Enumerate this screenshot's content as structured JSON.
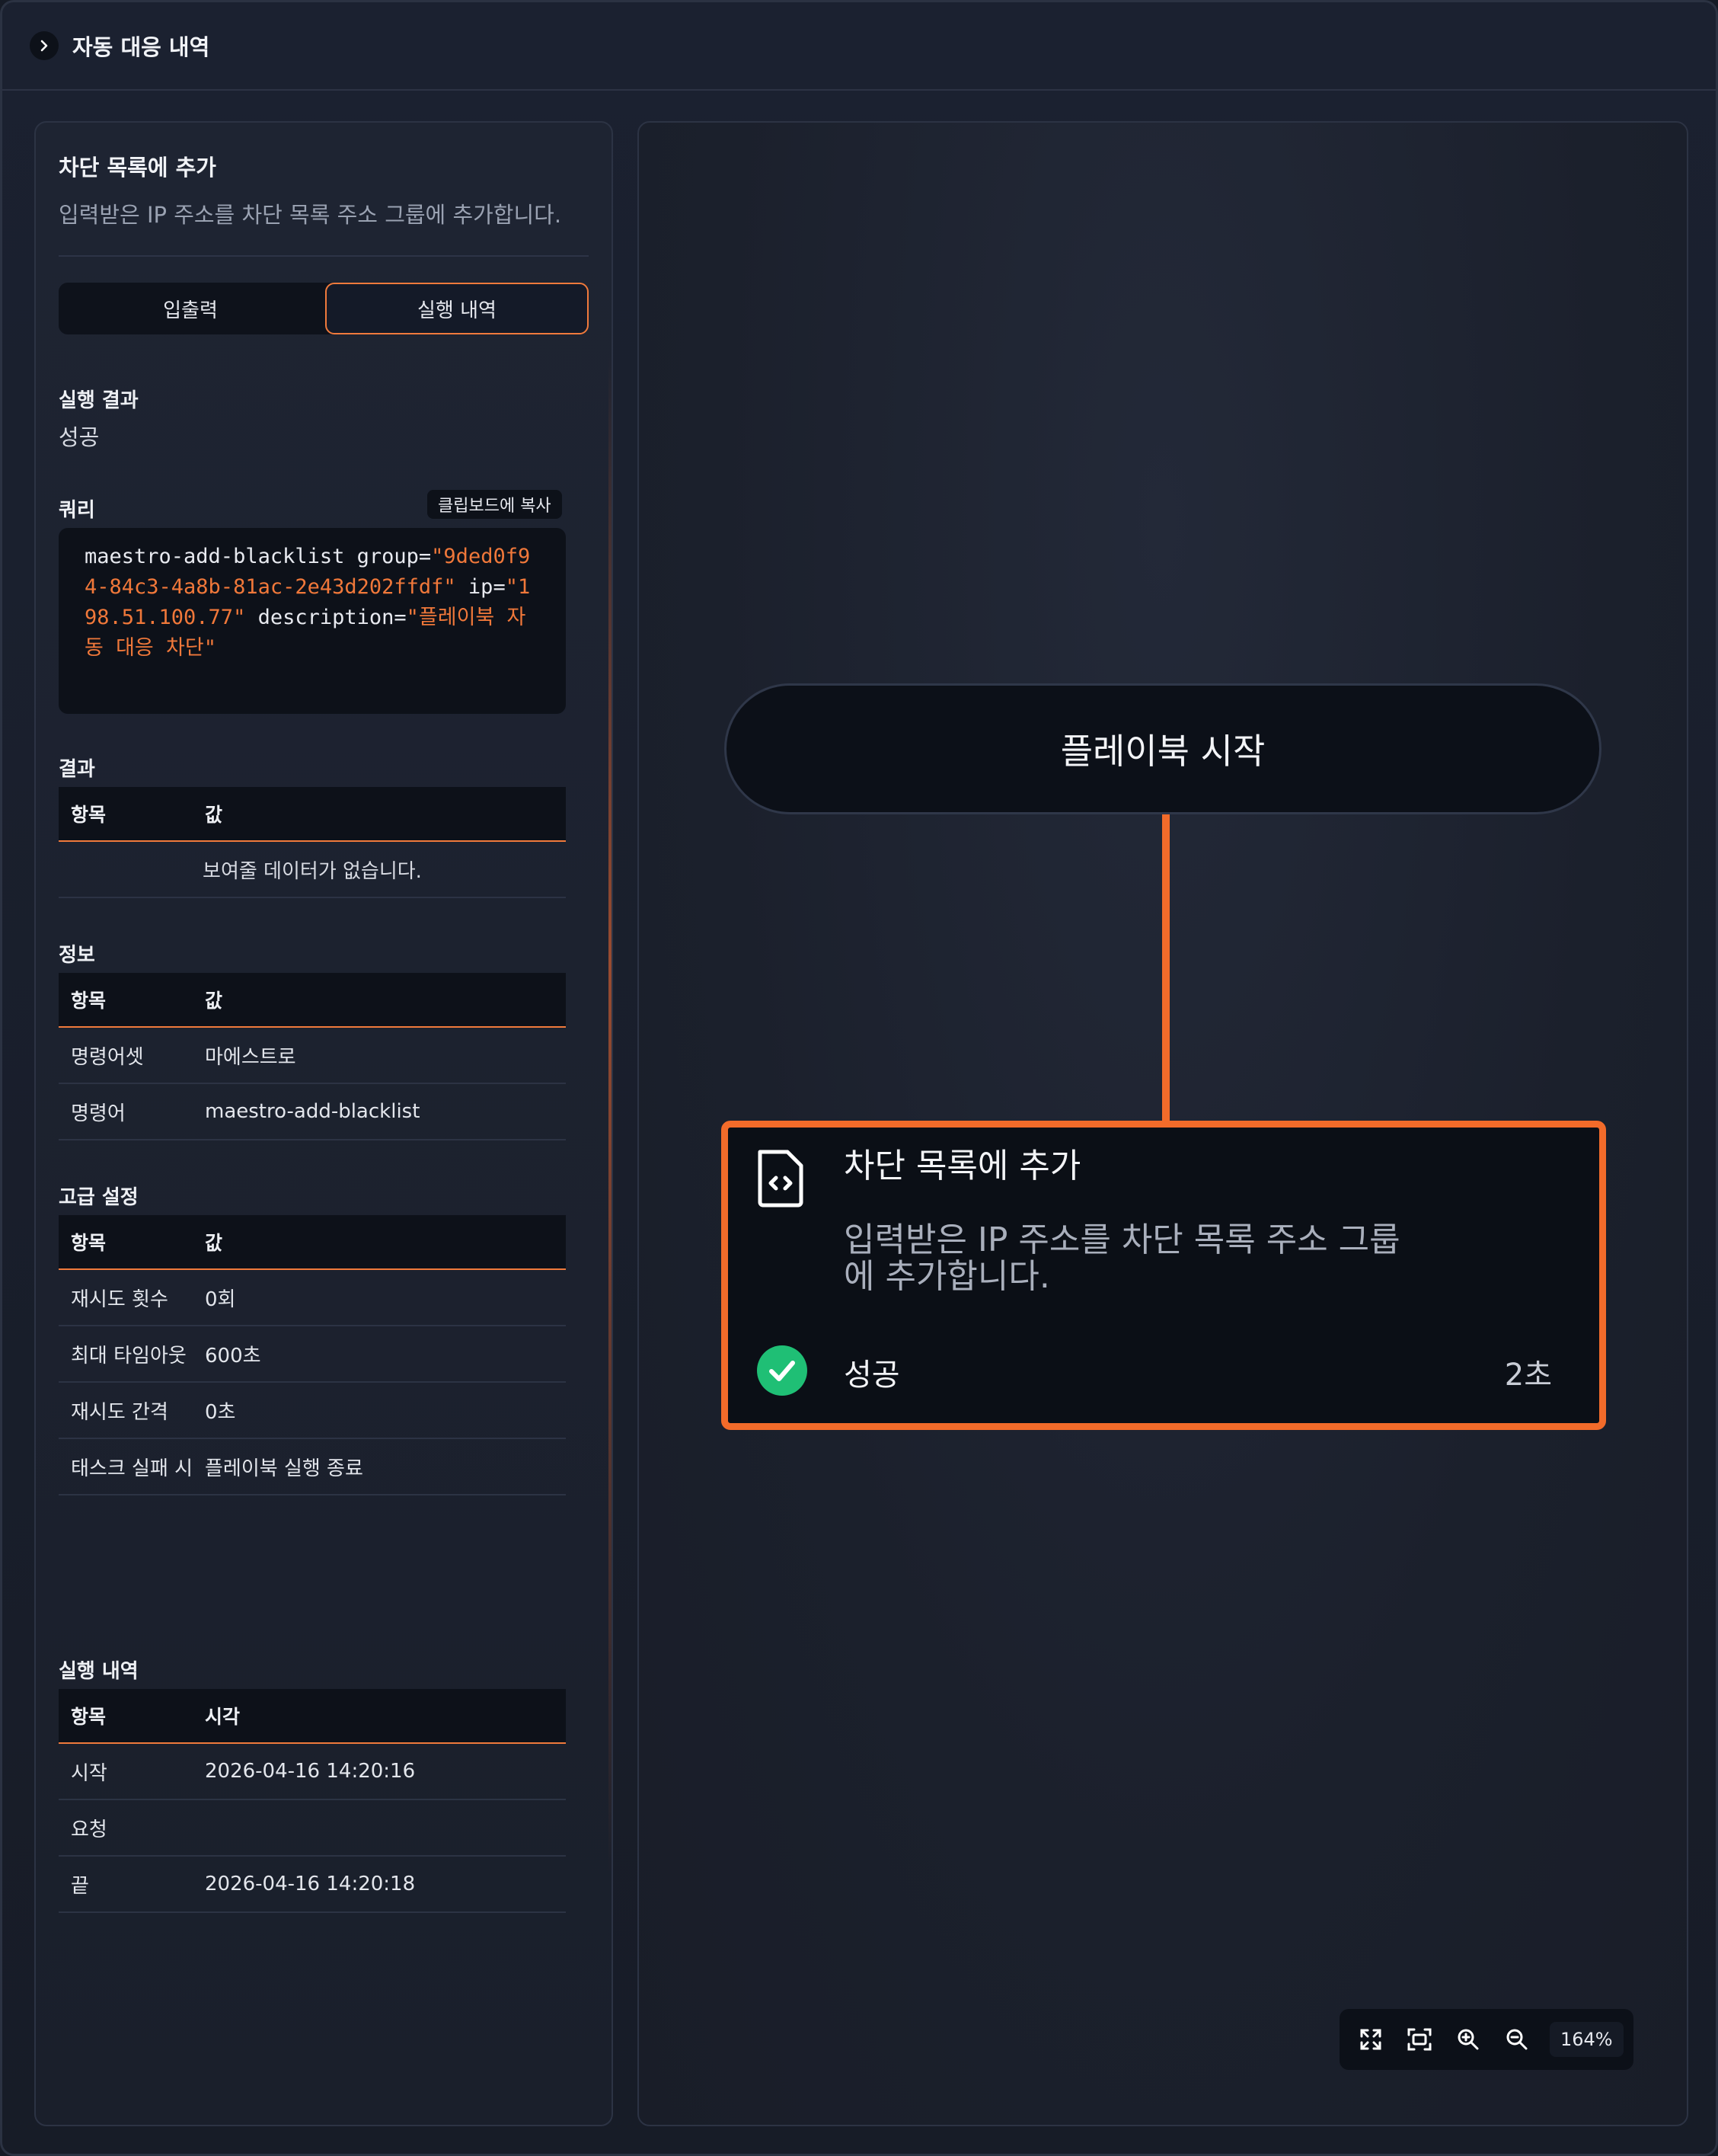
{
  "header": {
    "title": "자동 대응 내역"
  },
  "task": {
    "title": "차단 목록에 추가",
    "description": "입력받은 IP 주소를 차단 목록 주소 그룹에 추가합니다.",
    "description_line1": "입력받은 IP 주소를 차단 목록 주소 그룹",
    "description_line2": "에 추가합니다."
  },
  "tabs": {
    "io": "입출력",
    "history": "실행 내역"
  },
  "exec_result": {
    "label": "실행 결과",
    "value": "성공"
  },
  "query": {
    "label": "쿼리",
    "copy_label": "클립보드에 복사",
    "command": "maestro-add-blacklist",
    "group_key": " group=",
    "group_value": "\"9ded0f94-84c3-4a8b-81ac-2e43d202ffdf\"",
    "ip_key": " ip=",
    "ip_value": "\"198.51.100.77\"",
    "desc_key": " description=",
    "desc_value": "\"플레이북 자동 대응 차단\""
  },
  "result_table": {
    "label": "결과",
    "headers": [
      "항목",
      "값"
    ],
    "empty_text": "보여줄 데이터가 없습니다."
  },
  "info_table": {
    "label": "정보",
    "headers": [
      "항목",
      "값"
    ],
    "rows": [
      [
        "명령어셋",
        "마에스트로"
      ],
      [
        "명령어",
        "maestro-add-blacklist"
      ]
    ]
  },
  "advanced_table": {
    "label": "고급 설정",
    "headers": [
      "항목",
      "값"
    ],
    "rows": [
      [
        "재시도 횟수",
        "0회"
      ],
      [
        "최대 타임아웃",
        "600초"
      ],
      [
        "재시도 간격",
        "0초"
      ],
      [
        "태스크 실패 시",
        "플레이북 실행 종료"
      ]
    ]
  },
  "history_table": {
    "label": "실행 내역",
    "headers": [
      "항목",
      "시각"
    ],
    "rows": [
      [
        "시작",
        "2026-04-16 14:20:16"
      ],
      [
        "요청",
        ""
      ],
      [
        "끝",
        "2026-04-16 14:20:18"
      ]
    ]
  },
  "canvas": {
    "start_node_label": "플레이북 시작",
    "task_status": "성공",
    "task_duration": "2초",
    "zoom_level": "164%"
  },
  "colors": {
    "accent": "#f26b2a",
    "success": "#1fbf75",
    "background": "#161b26",
    "panel": "#1e2432"
  },
  "icons": {
    "header_toggle": "chevron-right-icon",
    "task": "code-file-icon",
    "status": "check-circle-icon",
    "fit": "expand-icon",
    "center": "focus-frame-icon",
    "zoom_in": "zoom-in-icon",
    "zoom_out": "zoom-out-icon"
  }
}
